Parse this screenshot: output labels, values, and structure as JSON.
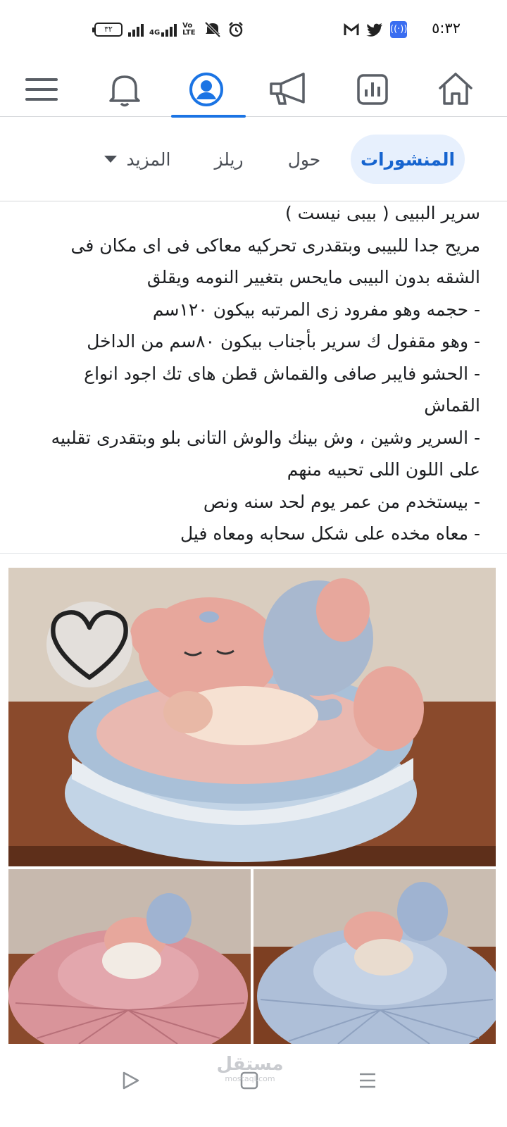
{
  "status_bar": {
    "time": "٥:٣٢",
    "battery": "٣٢",
    "network": "4G",
    "volte": "Vo LTE",
    "right_icons": [
      "gmail-icon",
      "twitter-icon",
      "radio-icon"
    ],
    "left_icons": [
      "battery-icon",
      "signal-icon",
      "4g-signal-icon",
      "volte-icon",
      "mute-icon",
      "alarm-icon"
    ]
  },
  "top_nav": {
    "items": [
      {
        "name": "home",
        "icon": "home-icon"
      },
      {
        "name": "dashboard",
        "icon": "dashboard-icon"
      },
      {
        "name": "ads",
        "icon": "megaphone-icon"
      },
      {
        "name": "profile",
        "icon": "profile-icon",
        "active": true
      },
      {
        "name": "notifications",
        "icon": "bell-icon"
      },
      {
        "name": "menu",
        "icon": "menu-icon"
      }
    ],
    "accent": "#1b74e4"
  },
  "profile_tabs": {
    "posts": "المنشورات",
    "about": "حول",
    "reels": "ريلز",
    "more": "المزيد"
  },
  "post": {
    "lines": [
      "سرير الببيى ( بيبى نيست )",
      "مريح جدا للبيبى وبتقدرى تحركيه معاكى فى اى مكان فى",
      "الشقه بدون البيبى مايحس بتغيير النومه ويقلق",
      "- حجمه وهو مفرود زى المرتبه بيكون ١٢٠سم",
      "- وهو مقفول ك سرير بأجناب بيكون ٨٠سم من الداخل",
      "- الحشو فايبر صافى والقماش قطن هاى تك اجود انواع",
      "القماش",
      "- السرير وشين ، وش بينك والوش التانى بلو وبتقدرى تقلبيه",
      "على اللون اللى تحبيه منهم",
      "- بيستخدم من عمر يوم لحد سنه ونص",
      "- معاه مخده على شكل سحابه ومعاه فيل"
    ]
  },
  "photos": {
    "like_icon": "heart-icon",
    "images": [
      "baby-nest-blue-photo",
      "baby-nest-pink-photo",
      "baby-nest-blue-flat-photo"
    ]
  },
  "system_nav": {
    "watermark": "مستقل",
    "watermark_sub": "mostaql.com",
    "buttons": [
      "back-icon",
      "home-square-icon",
      "recents-icon"
    ]
  }
}
